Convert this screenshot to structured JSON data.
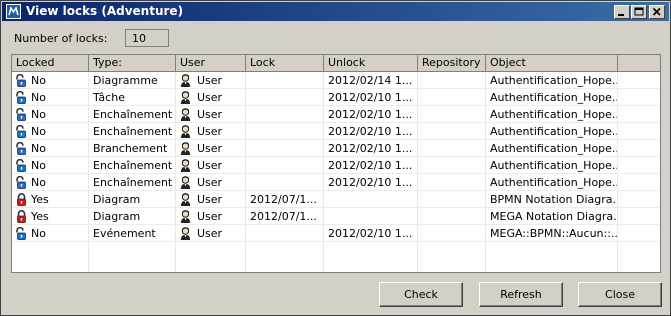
{
  "window": {
    "title": "View locks (Adventure)"
  },
  "lock_count": {
    "label": "Number of locks:",
    "value": "10"
  },
  "columns": [
    "Locked",
    "Type:",
    "User",
    "Lock",
    "Unlock",
    "Repository",
    "Object"
  ],
  "rows": [
    {
      "locked": "No",
      "type": "Diagramme",
      "user": "User",
      "lock": "",
      "unlock": "2012/02/14 1...",
      "repository": "",
      "object": "Authentification_Hope..."
    },
    {
      "locked": "No",
      "type": "Tâche",
      "user": "User",
      "lock": "",
      "unlock": "2012/02/10 1...",
      "repository": "",
      "object": "Authentification_Hope..."
    },
    {
      "locked": "No",
      "type": "Enchaînement",
      "user": "User",
      "lock": "",
      "unlock": "2012/02/10 1...",
      "repository": "",
      "object": "Authentification_Hope..."
    },
    {
      "locked": "No",
      "type": "Enchaînement",
      "user": "User",
      "lock": "",
      "unlock": "2012/02/10 1...",
      "repository": "",
      "object": "Authentification_Hope..."
    },
    {
      "locked": "No",
      "type": "Branchement",
      "user": "User",
      "lock": "",
      "unlock": "2012/02/10 1...",
      "repository": "",
      "object": "Authentification_Hope..."
    },
    {
      "locked": "No",
      "type": "Enchaînement",
      "user": "User",
      "lock": "",
      "unlock": "2012/02/10 1...",
      "repository": "",
      "object": "Authentification_Hope..."
    },
    {
      "locked": "No",
      "type": "Enchaînement",
      "user": "User",
      "lock": "",
      "unlock": "2012/02/10 1...",
      "repository": "",
      "object": "Authentification_Hope..."
    },
    {
      "locked": "Yes",
      "type": "Diagram",
      "user": "User",
      "lock": "2012/07/1...",
      "unlock": "",
      "repository": "",
      "object": "BPMN Notation Diagra..."
    },
    {
      "locked": "Yes",
      "type": "Diagram",
      "user": "User",
      "lock": "2012/07/1...",
      "unlock": "",
      "repository": "",
      "object": "MEGA Notation Diagra..."
    },
    {
      "locked": "No",
      "type": "Evénement",
      "user": "User",
      "lock": "",
      "unlock": "2012/02/10 1...",
      "repository": "",
      "object": "MEGA::BPMN::Aucun::..."
    }
  ],
  "icons": {
    "unlocked": "open-padlock-icon",
    "locked": "closed-padlock-icon",
    "user": "user-icon"
  },
  "colors": {
    "unlocked_lock": "#1f6fc4",
    "locked_lock": "#d01818",
    "titlebar": "#0a246a"
  },
  "buttons": {
    "check": "Check",
    "refresh": "Refresh",
    "close": "Close"
  }
}
